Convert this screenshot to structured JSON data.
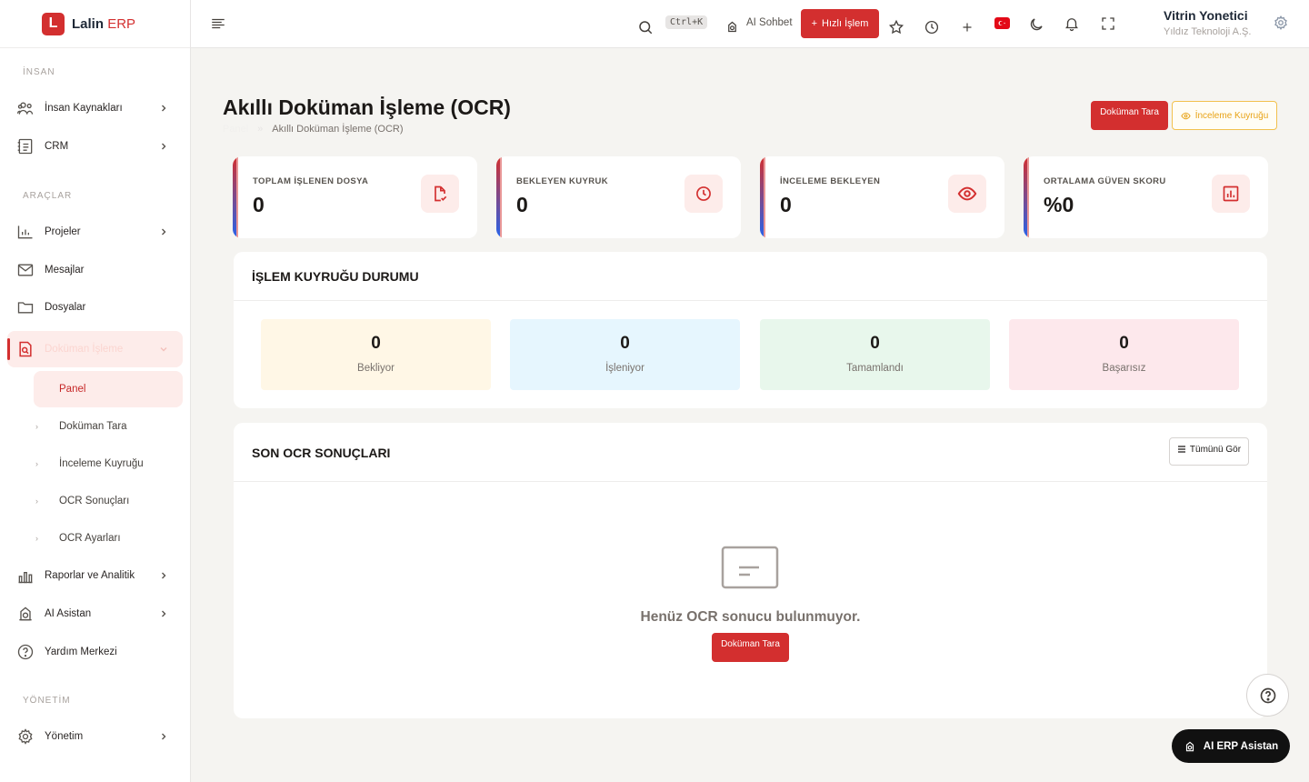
{
  "brand": {
    "logo_letter": "L",
    "name": "Lalin",
    "suffix": "ERP"
  },
  "sidebar": {
    "sections": {
      "insan": "İNSAN",
      "araclar": "ARAÇLAR",
      "yonetim": "YÖNETİM"
    },
    "items": {
      "insan_kaynaklari": "İnsan Kaynakları",
      "crm": "CRM",
      "projeler": "Projeler",
      "mesajlar": "Mesajlar",
      "dosyalar": "Dosyalar",
      "dokuman_isleme": "Doküman İşleme",
      "raporlar": "Raporlar ve Analitik",
      "ai_asistan": "AI Asistan",
      "yardim": "Yardım Merkezi",
      "yonetim": "Yönetim"
    },
    "sub_items": {
      "panel": "Panel",
      "dokuman_tara": "Doküman Tara",
      "inceleme_kuyrugu": "İnceleme Kuyruğu",
      "ocr_sonuclari": "OCR Sonuçları",
      "ocr_ayarlari": "OCR Ayarları"
    }
  },
  "topbar": {
    "shortcut": "Ctrl+K",
    "ai_chat": "AI Sohbet",
    "quick_action": "Hızlı İşlem",
    "user_name": "Vitrin Yonetici",
    "company": "Yıldız Teknoloji A.Ş."
  },
  "page": {
    "title": "Akıllı Doküman İşleme (OCR)",
    "breadcrumb": {
      "root": "Panel",
      "current": "Akıllı Doküman İşleme (OCR)"
    },
    "scan_button": "Doküman Tara",
    "review_button": "İnceleme Kuyruğu"
  },
  "stats": {
    "total_processed": {
      "label": "TOPLAM İŞLENEN DOSYA",
      "value": "0"
    },
    "pending_queue": {
      "label": "BEKLEYEN KUYRUK",
      "value": "0"
    },
    "pending_review": {
      "label": "İNCELEME BEKLEYEN",
      "value": "0"
    },
    "avg_confidence": {
      "label": "ORTALAMA GÜVEN SKORU",
      "value": "%0"
    }
  },
  "queue_panel": {
    "title": "İŞLEM KUYRUĞU DURUMU",
    "waiting": {
      "value": "0",
      "label": "Bekliyor"
    },
    "processing": {
      "value": "0",
      "label": "İşleniyor"
    },
    "completed": {
      "value": "0",
      "label": "Tamamlandı"
    },
    "failed": {
      "value": "0",
      "label": "Başarısız"
    }
  },
  "results_panel": {
    "title": "SON OCR SONUÇLARI",
    "view_all": "Tümünü Gör",
    "empty_text": "Henüz OCR sonucu bulunmuyor.",
    "empty_button": "Doküman Tara"
  },
  "fab": {
    "ai_assistant": "AI ERP Asistan"
  },
  "colors": {
    "primary": "#d32f2f",
    "waiting_bg": "#fff7e6",
    "processing_bg": "#e6f6fe",
    "completed_bg": "#e8f7ec",
    "failed_bg": "#fde8ec"
  }
}
